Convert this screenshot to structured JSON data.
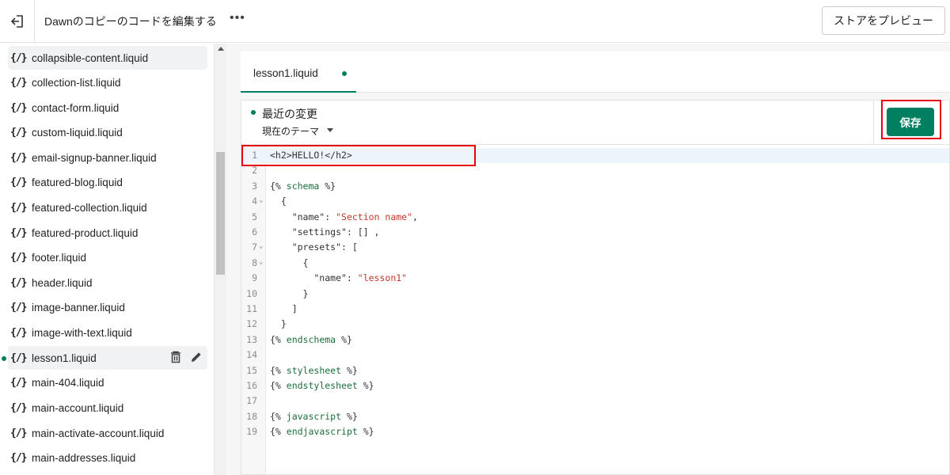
{
  "header": {
    "title": "Dawnのコピーのコードを編集する",
    "more_label": "•••",
    "preview_button": "ストアをプレビュー"
  },
  "sidebar": {
    "files": [
      {
        "icon": "{/}",
        "name": "collapsible-content.liquid"
      },
      {
        "icon": "{/}",
        "name": "collection-list.liquid"
      },
      {
        "icon": "{/}",
        "name": "contact-form.liquid"
      },
      {
        "icon": "{/}",
        "name": "custom-liquid.liquid"
      },
      {
        "icon": "{/}",
        "name": "email-signup-banner.liquid"
      },
      {
        "icon": "{/}",
        "name": "featured-blog.liquid"
      },
      {
        "icon": "{/}",
        "name": "featured-collection.liquid"
      },
      {
        "icon": "{/}",
        "name": "featured-product.liquid"
      },
      {
        "icon": "{/}",
        "name": "footer.liquid"
      },
      {
        "icon": "{/}",
        "name": "header.liquid"
      },
      {
        "icon": "{/}",
        "name": "image-banner.liquid"
      },
      {
        "icon": "{/}",
        "name": "image-with-text.liquid"
      },
      {
        "icon": "{/}",
        "name": "lesson1.liquid"
      },
      {
        "icon": "{/}",
        "name": "main-404.liquid"
      },
      {
        "icon": "{/}",
        "name": "main-account.liquid"
      },
      {
        "icon": "{/}",
        "name": "main-activate-account.liquid"
      },
      {
        "icon": "{/}",
        "name": "main-addresses.liquid"
      }
    ]
  },
  "tab": {
    "label": "lesson1.liquid"
  },
  "toolbar": {
    "recent_changes": "最近の変更",
    "theme_select": "現在のテーマ",
    "save_label": "保存"
  },
  "editor": {
    "lines": [
      "<h2>HELLO!</h2>",
      "",
      "{% schema %}",
      "  {",
      "    \"name\": \"Section name\",",
      "    \"settings\": [] ,",
      "    \"presets\": [",
      "      {",
      "        \"name\": \"lesson1\"",
      "      }",
      "    ]",
      "  }",
      "{% endschema %}",
      "",
      "{% stylesheet %}",
      "{% endstylesheet %}",
      "",
      "{% javascript %}",
      "{% endjavascript %}"
    ]
  },
  "colors": {
    "accent": "#008060",
    "highlight": "#e60012"
  }
}
